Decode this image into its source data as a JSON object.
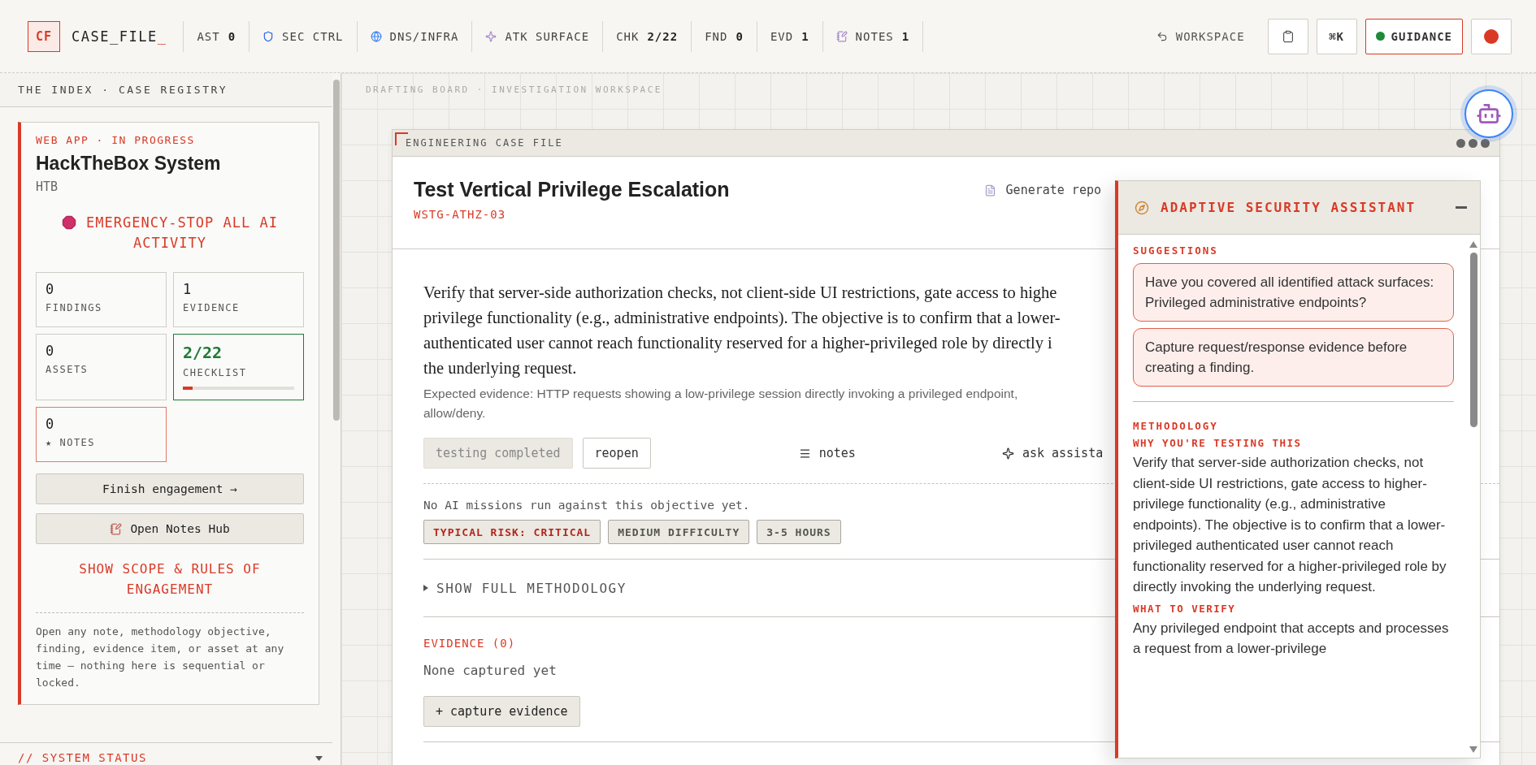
{
  "topbar": {
    "logo": "CF",
    "brand": "CASE_FILE",
    "cursor": "_",
    "items": [
      {
        "kind": "stat",
        "label": "AST",
        "value": "0"
      },
      {
        "kind": "link",
        "label": "SEC CTRL"
      },
      {
        "kind": "link",
        "label": "DNS/INFRA"
      },
      {
        "kind": "link",
        "label": "ATK SURFACE"
      },
      {
        "kind": "stat",
        "label": "CHK",
        "value": "2/22"
      },
      {
        "kind": "stat",
        "label": "FND",
        "value": "0"
      },
      {
        "kind": "stat",
        "label": "EVD",
        "value": "1"
      },
      {
        "kind": "link",
        "label": "NOTES",
        "value": "1"
      }
    ],
    "workspace_link": "WORKSPACE",
    "shortcut": "⌘K",
    "guidance": {
      "label": "GUIDANCE",
      "on": true
    }
  },
  "sidebar": {
    "title": "THE INDEX · CASE REGISTRY",
    "case": {
      "meta": "WEB APP · IN PROGRESS",
      "name": "HackTheBox System",
      "code": "HTB",
      "emergency": "EMERGENCY-STOP ALL AI ACTIVITY",
      "tiles": [
        {
          "kind": "count",
          "value": "0",
          "label": "FINDINGS"
        },
        {
          "kind": "count",
          "value": "1",
          "label": "EVIDENCE"
        },
        {
          "kind": "count",
          "value": "0",
          "label": "ASSETS"
        },
        {
          "kind": "progress",
          "value": "2/22",
          "label": "CHECKLIST",
          "level": 0.09
        },
        {
          "kind": "notes",
          "value": "0",
          "label": "★ NOTES"
        }
      ],
      "finish": "Finish engagement →",
      "notes_hub": "Open Notes Hub",
      "scope": "SHOW SCOPE & RULES OF ENGAGEMENT",
      "help": "Open any note, methodology objective, finding, evidence item, or asset at any time — nothing here is sequential or locked."
    },
    "status": "// SYSTEM STATUS"
  },
  "workspace": {
    "label": "DRAFTING BOARD · INVESTIGATION WORKSPACE",
    "case_file": {
      "header": "ENGINEERING CASE FILE",
      "title": "Test Vertical Privilege Escalation",
      "code": "WSTG-ATHZ-03",
      "report": "Generate repo",
      "objective_lines": [
        "Verify that server-side authorization checks, not client-side UI restrictions, gate access to highe",
        "privilege functionality (e.g., administrative endpoints). The objective is to confirm that a lower-",
        "authenticated user cannot reach functionality reserved for a higher-privileged role by directly i",
        "the underlying request."
      ],
      "evidence_lines": [
        "Expected evidence: HTTP requests showing a low-privilege session directly invoking a privileged endpoint,",
        "allow/deny."
      ],
      "actions": [
        {
          "kind": "button",
          "label": "testing completed",
          "disabled": true
        },
        {
          "kind": "button",
          "label": "reopen",
          "disabled": false
        },
        {
          "kind": "link",
          "label": "notes",
          "disabled": false
        },
        {
          "kind": "link",
          "label": "ask assista",
          "disabled": false
        }
      ],
      "missions": "No AI missions run against this objective yet.",
      "tags": [
        {
          "label": "TYPICAL RISK: CRITICAL",
          "color": "#b3261e"
        },
        {
          "label": "MEDIUM DIFFICULTY",
          "color": "#555550"
        },
        {
          "label": "3-5 HOURS",
          "color": "#555550"
        }
      ],
      "methodology": {
        "label": "SHOW FULL METHODOLOGY",
        "expanded": false
      },
      "evidence": {
        "title": "EVIDENCE (0)",
        "empty": "None captured yet",
        "capture": "+ capture evidence"
      }
    }
  },
  "assistant": {
    "title": "ADAPTIVE SECURITY ASSISTANT",
    "suggestions_label": "SUGGESTIONS",
    "suggestions": [
      "Have you covered all identified attack surfaces: Privileged administrative endpoints?",
      "Capture request/response evidence before creating a finding."
    ],
    "sections_label": "METHODOLOGY",
    "sections": [
      {
        "heading": "WHY YOU'RE TESTING THIS",
        "text": "Verify that server-side authorization checks, not client-side UI restrictions, gate access to higher-privilege functionality (e.g., administrative endpoints). The objective is to confirm that a lower-privileged authenticated user cannot reach functionality reserved for a higher-privileged role by directly invoking the underlying request."
      },
      {
        "heading": "WHAT TO VERIFY",
        "text": "Any privileged endpoint that accepts and processes a request from a lower-privilege"
      }
    ]
  }
}
